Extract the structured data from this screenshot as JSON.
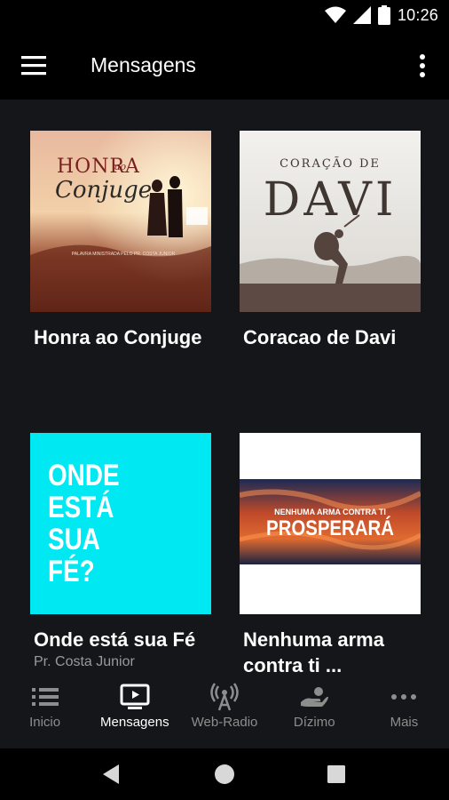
{
  "status_bar": {
    "time": "10:26"
  },
  "app_bar": {
    "title": "Mensagens"
  },
  "cards": [
    {
      "title": "Honra ao Conjuge",
      "subtitle": "",
      "art": {
        "line1": "HONRA",
        "line1_small": "ao",
        "line2": "Conjuge",
        "footer": "PALAVRA MINISTRADA PELO PR. COSTA JUNIOR"
      }
    },
    {
      "title": "Coracao de Davi",
      "subtitle": "",
      "art": {
        "line1": "CORAÇÃO DE",
        "line2": "DAVI"
      }
    },
    {
      "title": "Onde está sua Fé",
      "subtitle": "Pr. Costa Junior",
      "art": {
        "lines": [
          "ONDE",
          "ESTÁ",
          "SUA",
          "FÉ?"
        ]
      }
    },
    {
      "title": "Nenhuma arma contra ti ...",
      "subtitle": "",
      "art": {
        "line1": "NENHUMA ARMA CONTRA TI",
        "line2": "PROSPERARÁ"
      }
    }
  ],
  "bottom_nav": [
    {
      "label": "Inicio",
      "icon": "list-icon",
      "active": false
    },
    {
      "label": "Mensagens",
      "icon": "tv-play-icon",
      "active": true
    },
    {
      "label": "Web-Radio",
      "icon": "radio-tower-icon",
      "active": false
    },
    {
      "label": "Dízimo",
      "icon": "hand-offering-icon",
      "active": false
    },
    {
      "label": "Mais",
      "icon": "more-horizontal-icon",
      "active": false
    }
  ],
  "colors": {
    "background": "#151619",
    "bar": "#000000",
    "cyan_tile": "#00e8f2"
  }
}
